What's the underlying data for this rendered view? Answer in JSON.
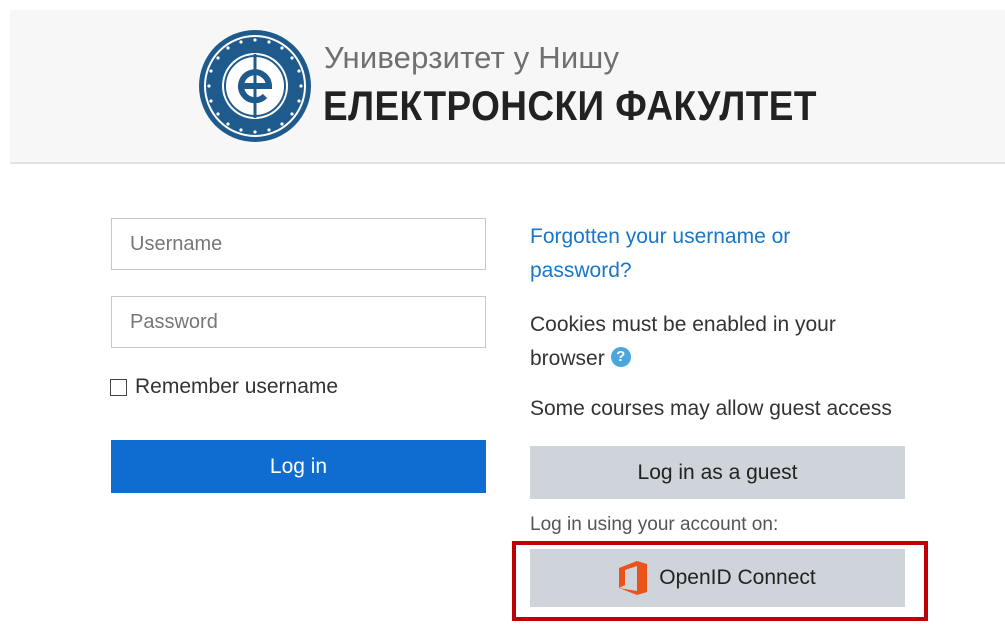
{
  "header": {
    "university": "Универзитет у Нишу",
    "faculty": "ЕЛЕКТРОНСКИ ФАКУЛТЕТ",
    "logo_icon": "university-seal-icon"
  },
  "login_form": {
    "username_placeholder": "Username",
    "username_value": "",
    "password_placeholder": "Password",
    "password_value": "",
    "remember_label": "Remember username",
    "remember_checked": false,
    "login_label": "Log in"
  },
  "sidebar": {
    "forgot_link": "Forgotten your username or password?",
    "cookies_text": "Cookies must be enabled in your browser",
    "help_icon": "question-circle-icon",
    "guest_note": "Some courses may allow guest access",
    "guest_button": "Log in as a guest",
    "account_note": "Log in using your account on:",
    "openid_button": "OpenID Connect",
    "openid_icon": "office-logo-icon"
  },
  "colors": {
    "primary": "#0f6cd1",
    "link": "#1877c8",
    "secondary_button": "#ced4da",
    "highlight": "#c00000",
    "office_orange": "#e8541c",
    "help_blue": "#4aa6dc"
  }
}
